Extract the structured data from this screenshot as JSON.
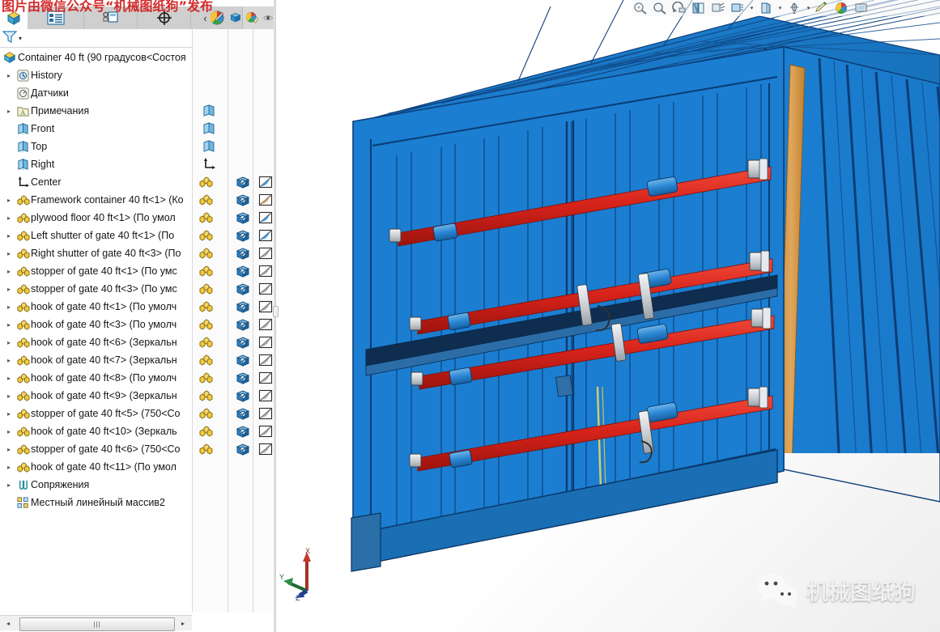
{
  "app": {
    "top_watermark": "图片由微信公众号“机械图纸狗”发布",
    "brand_watermark": "机械图纸狗"
  },
  "command_tabs": [
    {
      "name": "feature-manager-tab",
      "icon": "assembly-tree-icon",
      "active": true
    },
    {
      "name": "property-manager-tab",
      "icon": "property-list-icon",
      "active": false
    },
    {
      "name": "configuration-manager-tab",
      "icon": "configuration-icon",
      "active": false
    },
    {
      "name": "dimxpert-manager-tab",
      "icon": "dimxpert-target-icon",
      "active": false
    },
    {
      "name": "display-manager-tab",
      "icon": "display-palette-icon",
      "active": false
    }
  ],
  "tab_overflow": {
    "label": "‹",
    "icon": "chevron-left-icon"
  },
  "panel_icons": [
    {
      "name": "hide-show-pencil-icon"
    },
    {
      "name": "view-cube-icon"
    },
    {
      "name": "appearance-palette-icon"
    },
    {
      "name": "display-pane-eye-icon"
    }
  ],
  "filter_bar": {
    "icon": "filter-funnel-icon",
    "dropdown": "▾",
    "placeholder": ""
  },
  "tree": {
    "root": {
      "label": "Container 40 ft  (90 градусов<Состоя",
      "icon": "assembly-icon",
      "expandable": false
    },
    "items": [
      {
        "label": "History",
        "icon": "history-icon",
        "arrow": "▸",
        "indent": 1,
        "display": null
      },
      {
        "label": "Датчики",
        "icon": "sensors-icon",
        "arrow": "",
        "indent": 1,
        "display": null
      },
      {
        "label": "Примечания",
        "icon": "annotations-icon",
        "arrow": "▸",
        "indent": 1,
        "display": null
      },
      {
        "label": "Front",
        "icon": "plane-icon",
        "arrow": "",
        "indent": 1,
        "display": "plane"
      },
      {
        "label": "Top",
        "icon": "plane-icon",
        "arrow": "",
        "indent": 1,
        "display": "plane"
      },
      {
        "label": "Right",
        "icon": "plane-icon",
        "arrow": "",
        "indent": 1,
        "display": "plane"
      },
      {
        "label": "Center",
        "icon": "origin-icon",
        "arrow": "",
        "indent": 1,
        "display": "origin"
      },
      {
        "label": "Framework container 40 ft<1> (Ко",
        "icon": "component-icon",
        "arrow": "▸",
        "indent": 1,
        "display": "comp",
        "swatch": "blue-glossy"
      },
      {
        "label": "plywood floor 40 ft<1> (По умол",
        "icon": "component-icon",
        "arrow": "▸",
        "indent": 1,
        "display": "comp",
        "swatch": "wood"
      },
      {
        "label": "Left shutter of gate 40 ft<1> (По ",
        "icon": "component-icon",
        "arrow": "▸",
        "indent": 1,
        "display": "comp",
        "swatch": "blue"
      },
      {
        "label": "Right shutter of gate 40 ft<3> (По",
        "icon": "component-icon",
        "arrow": "▸",
        "indent": 1,
        "display": "comp",
        "swatch": "blue"
      },
      {
        "label": "stopper of gate 40 ft<1> (По умс",
        "icon": "component-icon",
        "arrow": "▸",
        "indent": 1,
        "display": "comp",
        "swatch": "grey"
      },
      {
        "label": "stopper of gate 40 ft<3> (По умс",
        "icon": "component-icon",
        "arrow": "▸",
        "indent": 1,
        "display": "comp",
        "swatch": "grey"
      },
      {
        "label": "hook of gate 40 ft<1> (По умолч",
        "icon": "component-icon",
        "arrow": "▸",
        "indent": 1,
        "display": "comp",
        "swatch": "grey"
      },
      {
        "label": "hook of gate 40 ft<3> (По умолч",
        "icon": "component-icon",
        "arrow": "▸",
        "indent": 1,
        "display": "comp",
        "swatch": "grey"
      },
      {
        "label": "hook of gate 40 ft<6> (Зеркальн",
        "icon": "component-icon",
        "arrow": "▸",
        "indent": 1,
        "display": "comp",
        "swatch": "grey"
      },
      {
        "label": "hook of gate 40 ft<7> (Зеркальн",
        "icon": "component-icon",
        "arrow": "▸",
        "indent": 1,
        "display": "comp",
        "swatch": "grey"
      },
      {
        "label": "hook of gate 40 ft<8> (По умолч",
        "icon": "component-icon",
        "arrow": "▸",
        "indent": 1,
        "display": "comp",
        "swatch": "grey"
      },
      {
        "label": "hook of gate 40 ft<9> (Зеркальн",
        "icon": "component-icon",
        "arrow": "▸",
        "indent": 1,
        "display": "comp",
        "swatch": "grey"
      },
      {
        "label": "stopper of gate 40 ft<5> (750<Со",
        "icon": "component-icon",
        "arrow": "▸",
        "indent": 1,
        "display": "comp",
        "swatch": "grey"
      },
      {
        "label": "hook of gate 40 ft<10> (Зеркаль",
        "icon": "component-icon",
        "arrow": "▸",
        "indent": 1,
        "display": "comp",
        "swatch": "grey"
      },
      {
        "label": "stopper of gate 40 ft<6> (750<Со",
        "icon": "component-icon",
        "arrow": "▸",
        "indent": 1,
        "display": "comp",
        "swatch": "grey"
      },
      {
        "label": "hook of gate 40 ft<11> (По умол",
        "icon": "component-icon",
        "arrow": "▸",
        "indent": 1,
        "display": "comp",
        "swatch": "grey"
      },
      {
        "label": "Сопряжения",
        "icon": "mates-icon",
        "arrow": "▸",
        "indent": 1,
        "display": null
      },
      {
        "label": "Местный линейный массив2",
        "icon": "local-pattern-icon",
        "arrow": "",
        "indent": 1,
        "display": null
      }
    ]
  },
  "display_pane": {
    "columns": [
      "hide-show-column",
      "display-mode-column",
      "appearance-column"
    ]
  },
  "top_toolbar": [
    {
      "name": "zoom-to-area-icon",
      "caret": false
    },
    {
      "name": "zoom-in-out-icon",
      "caret": false
    },
    {
      "name": "rotate-view-icon",
      "caret": false
    },
    {
      "name": "section-view-icon",
      "caret": false
    },
    {
      "name": "view-orientation-icon",
      "caret": false
    },
    {
      "name": "display-style-icon",
      "caret": true
    },
    {
      "name": "hide-show-items-icon",
      "caret": true
    },
    {
      "name": "apply-scene-icon",
      "caret": true
    },
    {
      "name": "view-settings-icon",
      "caret": false
    },
    {
      "name": "edit-appearance-icon",
      "caret": false
    },
    {
      "name": "view-palette-icon",
      "caret": false
    }
  ],
  "scrollbar": {
    "left_arrow": "◂",
    "right_arrow": "▸",
    "grip": "|||"
  },
  "triad": {
    "x": "X",
    "y": "Y",
    "z": "Z"
  },
  "colors": {
    "container_blue": "#1b7fd4",
    "container_blue_dark": "#0d3f7a",
    "rod_red": "#d8241b",
    "wood": "#d99a4e",
    "hardware_grey": "#c9cdd2",
    "viewport_bg": "#ffffff",
    "watermark_red": "#d21c1c"
  }
}
